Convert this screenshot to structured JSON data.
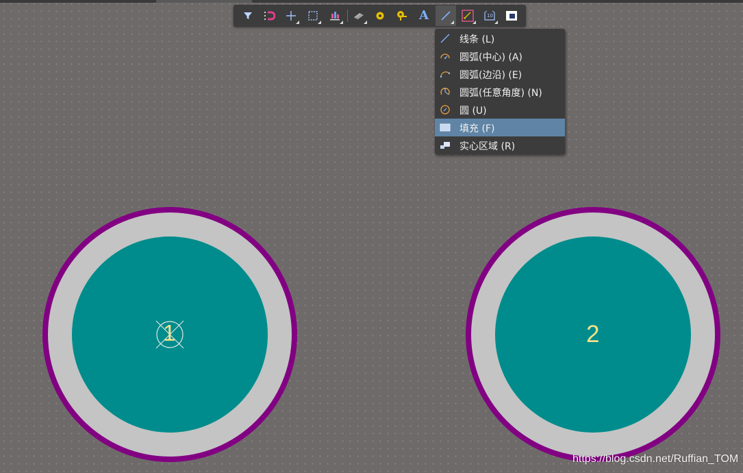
{
  "toolbar": {
    "tools": [
      {
        "name": "filter-icon"
      },
      {
        "name": "snap-magnet-icon"
      },
      {
        "name": "crosshair-icon"
      },
      {
        "name": "rect-select-icon"
      },
      {
        "name": "align-icon"
      },
      {
        "name": "component-icon"
      },
      {
        "name": "via-icon"
      },
      {
        "name": "pad-icon"
      },
      {
        "name": "text-icon",
        "glyph": "A"
      },
      {
        "name": "line-icon"
      },
      {
        "name": "dimension-icon"
      },
      {
        "name": "polygon-icon"
      },
      {
        "name": "board-icon"
      }
    ],
    "selected": "line-icon"
  },
  "menu": {
    "items": [
      {
        "label": "线条 (L)",
        "icon": "line-icon"
      },
      {
        "label": "圆弧(中心) (A)",
        "icon": "arc-center-icon"
      },
      {
        "label": "圆弧(边沿) (E)",
        "icon": "arc-edge-icon"
      },
      {
        "label": "圆弧(任意角度) (N)",
        "icon": "arc-any-angle-icon"
      },
      {
        "label": "圆 (U)",
        "icon": "circle-icon"
      },
      {
        "label": "填充 (F)",
        "icon": "fill-icon",
        "highlighted": true
      },
      {
        "label": "实心区域 (R)",
        "icon": "solid-region-icon"
      }
    ]
  },
  "pads": [
    {
      "label": "1",
      "origin_marker": true
    },
    {
      "label": "2",
      "origin_marker": false
    }
  ],
  "colors": {
    "background": "#6f6a6a",
    "pad_outline": "#820082",
    "pad_ring": "#c4c4c4",
    "pad_copper": "#008c8c",
    "pad_label": "#f5e28a",
    "menu_highlight": "#5f84a5"
  },
  "watermark": "https://blog.csdn.net/Ruffian_TOM"
}
